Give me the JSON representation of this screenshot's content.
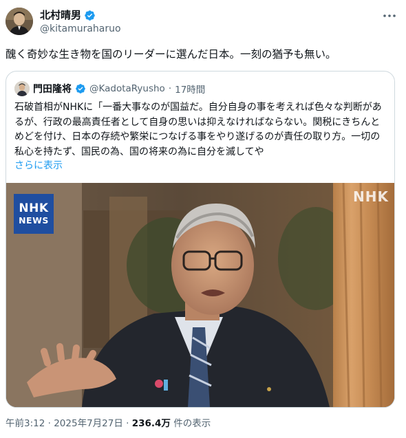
{
  "author": {
    "display_name": "北村晴男",
    "handle": "@kitamuraharuo"
  },
  "tweet": {
    "text": "醜く奇妙な生き物を国のリーダーに選んだ日本。一刻の猶予も無い。"
  },
  "quote": {
    "display_name": "門田隆将",
    "handle": "@KadotaRyusho",
    "separator": "·",
    "time": "17時間",
    "text": "石破首相がNHKに「一番大事なのが国益だ。自分自身の事を考えれば色々な判断があるが、行政の最高責任者として自身の思いは抑えなければならない。関税にきちんとめどを付け、日本の存続や繁栄につなげる事をやり遂げるのが責任の取り方。一切の私心を持たず、国民の為、国の将来の為に自分を滅してや",
    "show_more": "さらに表示",
    "media": {
      "logo_line1": "NHK",
      "logo_line2": "NEWS",
      "watermark": "NHK"
    }
  },
  "meta": {
    "time": "午前3:12",
    "dot1": "·",
    "date": "2025年7月27日",
    "dot2": "·",
    "views_count": "236.4万",
    "views_label": "件の表示"
  },
  "colors": {
    "verified": "#1d9bf0",
    "link": "#1d9bf0",
    "secondary_text": "#536471",
    "border": "#cfd9de",
    "nhk_blue": "#1f4ea0"
  },
  "icons": {
    "verified": "verified-badge-icon",
    "more": "more-options-icon"
  }
}
